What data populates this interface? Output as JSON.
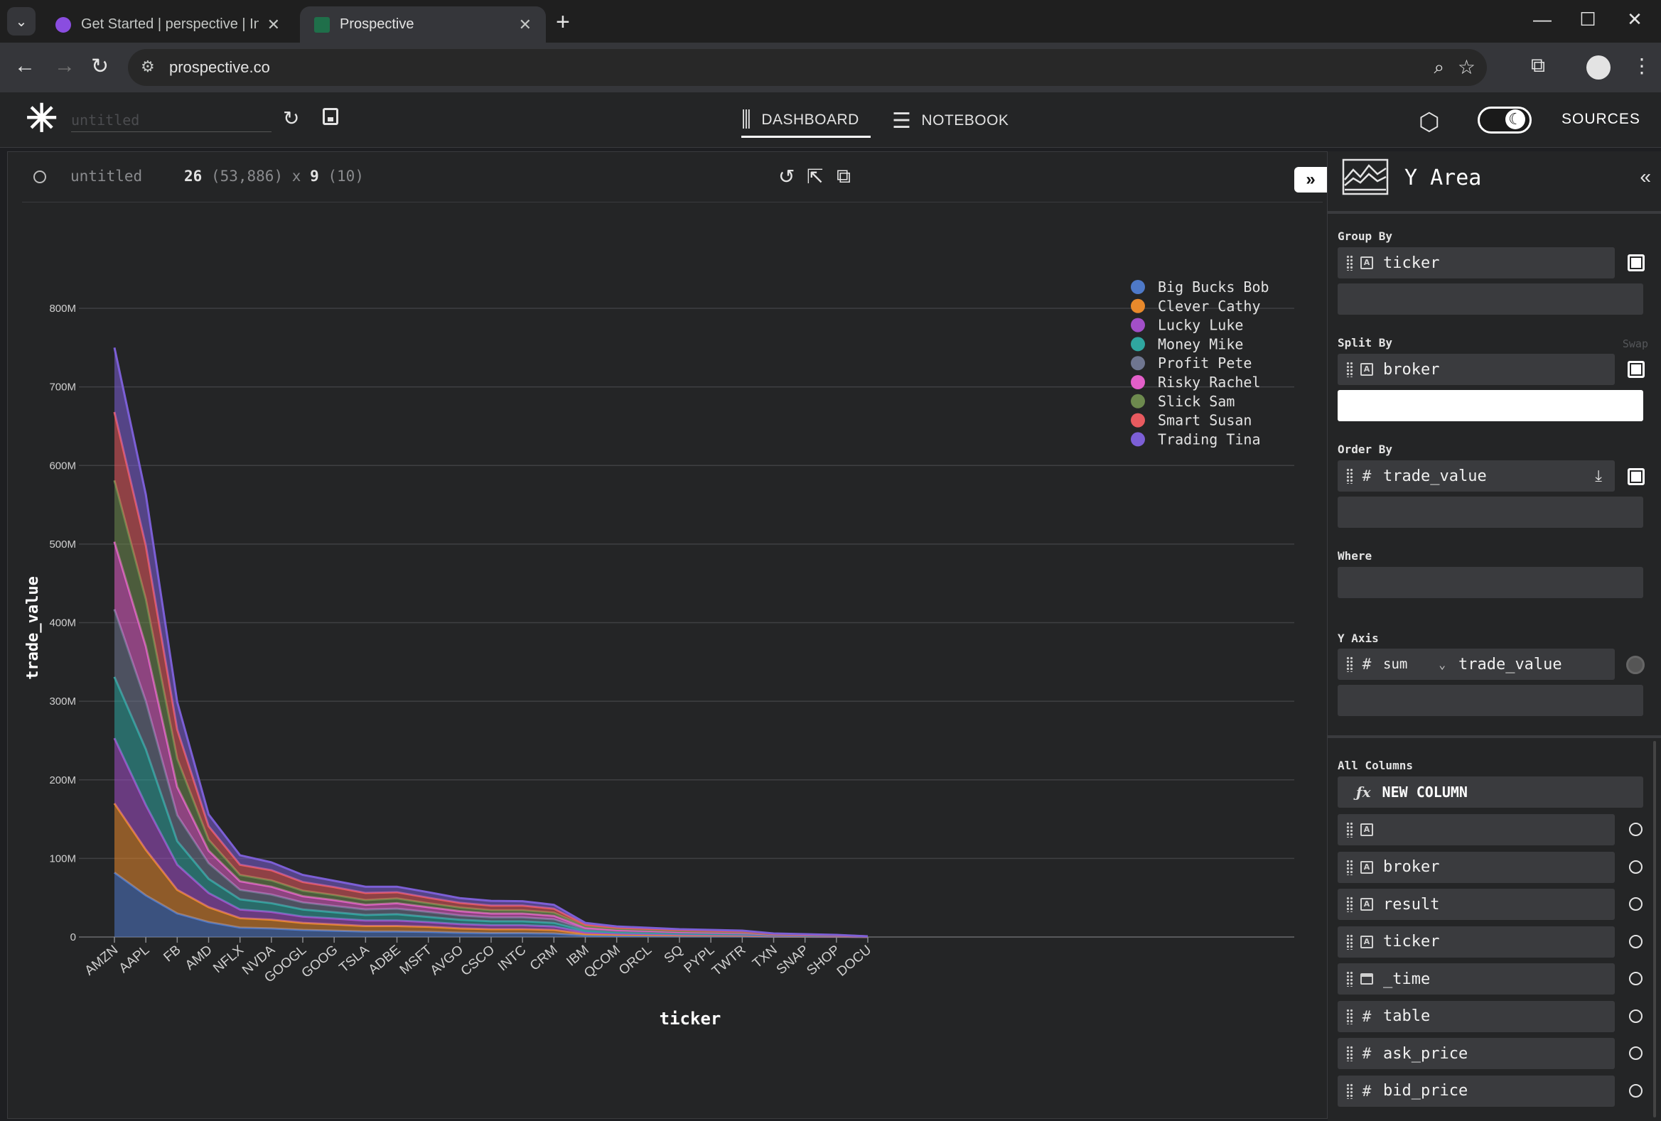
{
  "browser": {
    "tabs": [
      {
        "title": "Get Started | perspective | Influx",
        "active": false
      },
      {
        "title": "Prospective",
        "active": true
      }
    ],
    "url": "prospective.co"
  },
  "app": {
    "title_placeholder": "untitled",
    "nav": {
      "dashboard": "DASHBOARD",
      "notebook": "NOTEBOOK"
    },
    "sources": "SOURCES"
  },
  "viewer": {
    "title": "untitled",
    "rows": "26",
    "total_rows": "(53,886)",
    "times": "x",
    "columns": "9",
    "total_columns": "(10)"
  },
  "panel": {
    "plugin": "Y Area",
    "group_by": {
      "label": "Group By",
      "items": [
        "ticker"
      ]
    },
    "split_by": {
      "label": "Split By",
      "swap": "Swap",
      "items": [
        "broker"
      ]
    },
    "order_by": {
      "label": "Order By",
      "items": [
        "trade_value"
      ]
    },
    "where": {
      "label": "Where"
    },
    "y_axis": {
      "label": "Y Axis",
      "aggregate": "sum",
      "column": "trade_value"
    },
    "all_columns": {
      "label": "All Columns",
      "new_column": "NEW COLUMN",
      "items": [
        {
          "name": "",
          "type": "string"
        },
        {
          "name": "broker",
          "type": "string"
        },
        {
          "name": "result",
          "type": "string"
        },
        {
          "name": "ticker",
          "type": "string"
        },
        {
          "name": "_time",
          "type": "datetime"
        },
        {
          "name": "table",
          "type": "number"
        },
        {
          "name": "ask_price",
          "type": "number"
        },
        {
          "name": "bid_price",
          "type": "number"
        }
      ]
    }
  },
  "colors": {
    "Big Bucks Bob": "#4e79c8",
    "Clever Cathy": "#e8892b",
    "Lucky Luke": "#a24fc8",
    "Money Mike": "#2fa6a0",
    "Profit Pete": "#6f7690",
    "Risky Rachel": "#e35fc9",
    "Slick Sam": "#6d8a4e",
    "Smart Susan": "#e85a5f",
    "Trading Tina": "#7c5fd6"
  },
  "chart_data": {
    "type": "area",
    "stacked": true,
    "xlabel": "ticker",
    "ylabel": "trade_value",
    "ylim": [
      0,
      800000000
    ],
    "yticks": [
      "0",
      "100M",
      "200M",
      "300M",
      "400M",
      "500M",
      "600M",
      "700M",
      "800M"
    ],
    "legend_position": "top-right",
    "grid": true,
    "categories": [
      "AMZN",
      "AAPL",
      "FB",
      "AMD",
      "NFLX",
      "NVDA",
      "GOOGL",
      "GOOG",
      "TSLA",
      "ADBE",
      "MSFT",
      "AVGO",
      "CSCO",
      "INTC",
      "CRM",
      "IBM",
      "QCOM",
      "ORCL",
      "SQ",
      "PYPL",
      "TWTR",
      "TXN",
      "SNAP",
      "SHOP",
      "DOCU"
    ],
    "series": [
      {
        "name": "Big Bucks Bob",
        "values": [
          82,
          53,
          30,
          19,
          12,
          11,
          9,
          8,
          7,
          7,
          6.5,
          5.5,
          5,
          5,
          4.5,
          2,
          1.5,
          1.3,
          1.1,
          1,
          0.9,
          0.5,
          0.4,
          0.3,
          0.1
        ]
      },
      {
        "name": "Clever Cathy",
        "values": [
          88,
          58,
          30,
          19,
          12,
          11,
          9,
          8,
          7,
          7,
          6.5,
          5.5,
          5,
          5,
          4.5,
          2,
          1.5,
          1.3,
          1.1,
          1,
          0.9,
          0.5,
          0.4,
          0.3,
          0.1
        ]
      },
      {
        "name": "Lucky Luke",
        "values": [
          83,
          57,
          32,
          18,
          11,
          10,
          8,
          7.5,
          7,
          7,
          6,
          5.5,
          5,
          5,
          4.5,
          2,
          1.5,
          1.3,
          1.1,
          1,
          0.9,
          0.5,
          0.4,
          0.3,
          0.1
        ]
      },
      {
        "name": "Money Mike",
        "values": [
          78,
          71,
          30,
          18,
          13,
          11,
          9,
          8,
          7,
          8,
          6.5,
          5.5,
          5,
          5,
          4.5,
          2,
          1.5,
          1.3,
          1.1,
          1,
          0.9,
          0.5,
          0.4,
          0.3,
          0.1
        ]
      },
      {
        "name": "Profit Pete",
        "values": [
          86,
          61,
          33,
          20,
          12,
          11,
          9,
          8,
          7,
          7,
          6.5,
          5.5,
          5,
          5,
          4.5,
          2,
          1.5,
          1.3,
          1.1,
          1,
          0.9,
          0.5,
          0.4,
          0.3,
          0.1
        ]
      },
      {
        "name": "Risky Rachel",
        "values": [
          86,
          70,
          36,
          16,
          11,
          10,
          8,
          7.5,
          6,
          7,
          6,
          5.5,
          5,
          5,
          4.5,
          2,
          1.5,
          1.3,
          1.1,
          1,
          0.9,
          0.5,
          0.4,
          0.3,
          0.1
        ]
      },
      {
        "name": "Slick Sam",
        "values": [
          78,
          60,
          36,
          14,
          8,
          8,
          7,
          6.5,
          6,
          6,
          5,
          4.5,
          4,
          4,
          4,
          2,
          1.5,
          1.3,
          1.1,
          1,
          0.9,
          0.5,
          0.4,
          0.3,
          0.1
        ]
      },
      {
        "name": "Smart Susan",
        "values": [
          87,
          68,
          37,
          17,
          13,
          13,
          11,
          10,
          9,
          8,
          7,
          6,
          6,
          6,
          5,
          2,
          1.5,
          1.3,
          1.1,
          1,
          0.9,
          0.5,
          0.4,
          0.3,
          0.1
        ]
      },
      {
        "name": "Trading Tina",
        "values": [
          82,
          65,
          35,
          15,
          12,
          10,
          9,
          8,
          8,
          7,
          7,
          6,
          6,
          5.5,
          5,
          2,
          1.5,
          1.3,
          1.1,
          1,
          0.9,
          0.5,
          0.4,
          0.3,
          0.1
        ]
      }
    ],
    "value_unit": "M"
  }
}
